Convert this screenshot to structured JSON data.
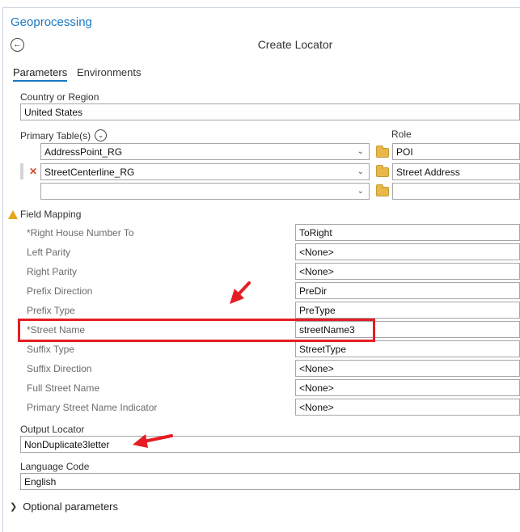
{
  "pane": {
    "title": "Geoprocessing"
  },
  "tool": {
    "title": "Create Locator"
  },
  "tabs": [
    {
      "label": "Parameters"
    },
    {
      "label": "Environments"
    }
  ],
  "country": {
    "label": "Country or Region",
    "value": "United States"
  },
  "primary_tables": {
    "label": "Primary Table(s)",
    "role_label": "Role",
    "rows": [
      {
        "table": "AddressPoint_RG",
        "role": "POI"
      },
      {
        "table": "StreetCenterline_RG",
        "role": "Street Address"
      },
      {
        "table": "",
        "role": ""
      }
    ]
  },
  "field_mapping": {
    "label": "Field Mapping",
    "rows": [
      {
        "name": "*Right House Number To",
        "value": "ToRight"
      },
      {
        "name": "Left Parity",
        "value": "<None>"
      },
      {
        "name": "Right Parity",
        "value": "<None>"
      },
      {
        "name": "Prefix Direction",
        "value": "PreDir"
      },
      {
        "name": "Prefix Type",
        "value": "PreType"
      },
      {
        "name": "*Street Name",
        "value": "streetName3"
      },
      {
        "name": "Suffix Type",
        "value": "StreetType"
      },
      {
        "name": "Suffix Direction",
        "value": "<None>"
      },
      {
        "name": "Full Street Name",
        "value": "<None>"
      },
      {
        "name": "Primary Street Name Indicator",
        "value": "<None>"
      }
    ]
  },
  "output_locator": {
    "label": "Output Locator",
    "value": "NonDuplicate3letter"
  },
  "language_code": {
    "label": "Language Code",
    "value": "English"
  },
  "optional_parameters": {
    "label": "Optional parameters"
  },
  "colors": {
    "accent": "#1a78c2",
    "annotation_red": "#e51d24",
    "warning": "#e8a317"
  },
  "icons": [
    "back-arrow-icon",
    "chevron-down-icon",
    "dropdown-arrow-icon",
    "folder-icon",
    "remove-x-icon",
    "warning-icon",
    "chevron-right-icon",
    "annotation-arrow-icon"
  ]
}
